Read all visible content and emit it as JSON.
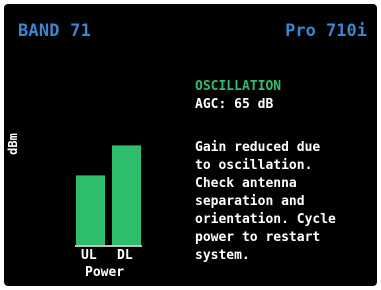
{
  "header": {
    "band": "BAND 71",
    "model": "Pro 710i"
  },
  "status": {
    "title": "OSCILLATION",
    "agc": "AGC: 65 dB",
    "message_lines": [
      "Gain reduced due",
      "to oscillation.",
      "Check antenna",
      "separation and",
      "orientation. Cycle",
      "power to restart",
      "system."
    ]
  },
  "chart_data": {
    "type": "bar",
    "categories": [
      "UL",
      "DL"
    ],
    "values": [
      0.58,
      0.83
    ],
    "value_scale": "fraction of full scale",
    "ylabel": "dBm",
    "xlabel": "Power",
    "ylim": [
      0,
      1
    ],
    "grid": false,
    "colors": {
      "bar": "#2ebd6b",
      "axis": "#ffffff"
    }
  },
  "colors": {
    "background": "#000000",
    "header": "#3b86cf",
    "status_title": "#2ebd6b",
    "text": "#ffffff"
  }
}
